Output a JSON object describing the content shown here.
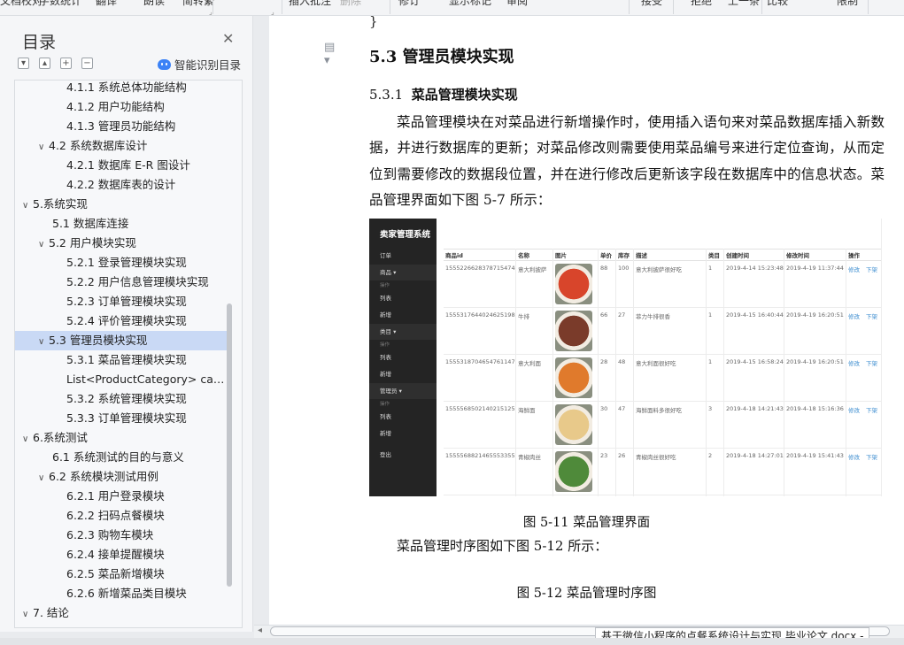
{
  "toolbar": {
    "items": [
      "文档校对",
      "字数统计",
      "翻译",
      "朗读",
      "简转繁",
      "插入批注",
      "删除",
      "修订",
      "显示标记",
      "审阅",
      "接受",
      "拒绝",
      "上一条",
      "比较",
      "限制"
    ]
  },
  "toc": {
    "title": "目录",
    "smart_label": "智能识别目录",
    "controls": [
      "expand",
      "collapse",
      "add-level",
      "remove-level"
    ],
    "items": [
      {
        "label": "4.1.1 系统总体功能结构",
        "level": 3
      },
      {
        "label": "4.1.2 用户功能结构",
        "level": 3
      },
      {
        "label": "4.1.3 管理员功能结构",
        "level": 3
      },
      {
        "label": "4.2 系统数据库设计",
        "level": 2,
        "expanded": true
      },
      {
        "label": "4.2.1 数据库 E-R 图设计",
        "level": 3
      },
      {
        "label": "4.2.2 数据库表的设计",
        "level": 3
      },
      {
        "label": "5.系统实现",
        "level": 1,
        "expanded": true
      },
      {
        "label": "5.1 数据库连接",
        "level": 2
      },
      {
        "label": "5.2 用户模块实现",
        "level": 2,
        "expanded": true
      },
      {
        "label": "5.2.1 登录管理模块实现",
        "level": 3
      },
      {
        "label": "5.2.2 用户信息管理模块实现",
        "level": 3
      },
      {
        "label": "5.2.3 订单管理模块实现",
        "level": 3
      },
      {
        "label": "5.2.4 评价管理模块实现",
        "level": 3
      },
      {
        "label": "5.3 管理员模块实现",
        "level": 2,
        "expanded": true,
        "active": true
      },
      {
        "label": "5.3.1 菜品管理模块实现",
        "level": 3
      },
      {
        "label": "List<ProductCategory> categoryList = pro...",
        "level": 3
      },
      {
        "label": "5.3.2 系统管理模块实现",
        "level": 3
      },
      {
        "label": "5.3.3 订单管理模块实现",
        "level": 3
      },
      {
        "label": "6.系统测试",
        "level": 1,
        "expanded": true
      },
      {
        "label": "6.1 系统测试的目的与意义",
        "level": 2
      },
      {
        "label": "6.2 系统模块测试用例",
        "level": 2,
        "expanded": true
      },
      {
        "label": "6.2.1 用户登录模块",
        "level": 3
      },
      {
        "label": "6.2.2 扫码点餐模块",
        "level": 3
      },
      {
        "label": "6.2.3 购物车模块",
        "level": 3
      },
      {
        "label": "6.2.4 接单提醒模块",
        "level": 3
      },
      {
        "label": "6.2.5 菜品新增模块",
        "level": 3
      },
      {
        "label": "6.2.6 新增菜品类目模块",
        "level": 3
      },
      {
        "label": "7. 结论",
        "level": 1,
        "expanded": true
      }
    ]
  },
  "document": {
    "closing_brace": "}",
    "heading_2": "5.3  管理员模块实现",
    "heading_3_num": "5.3.1",
    "heading_3_text": "菜品管理模块实现",
    "paragraph": "菜品管理模块在对菜品进行新增操作时，使用插入语句来对菜品数据库插入新数据，并进行数据库的更新；对菜品修改则需要使用菜品编号来进行定位查询，从而定位到需要修改的数据段位置，并在进行修改后更新该字段在数据库中的信息状态。菜品管理界面如下图 5-7 所示：",
    "figure_caption": "图 5-11 菜品管理界面",
    "paragraph_2": "菜品管理时序图如下图 5-12 所示：",
    "figure_caption_2": "图 5-12 菜品管理时序图"
  },
  "screenshot": {
    "brand": "卖家管理系统",
    "menu": [
      {
        "label": "订单",
        "type": "item"
      },
      {
        "label": "商品 ▾",
        "type": "group"
      },
      {
        "label": "操作",
        "type": "label"
      },
      {
        "label": "列表",
        "type": "item"
      },
      {
        "label": "新增",
        "type": "item"
      },
      {
        "label": "类目 ▾",
        "type": "group"
      },
      {
        "label": "操作",
        "type": "label"
      },
      {
        "label": "列表",
        "type": "item"
      },
      {
        "label": "新增",
        "type": "item"
      },
      {
        "label": "管理员 ▾",
        "type": "group"
      },
      {
        "label": "操作",
        "type": "label"
      },
      {
        "label": "列表",
        "type": "item"
      },
      {
        "label": "新增",
        "type": "item"
      },
      {
        "label": "登出",
        "type": "item"
      }
    ],
    "columns": [
      "商品id",
      "名称",
      "图片",
      "单价",
      "库存",
      "描述",
      "类目",
      "创建时间",
      "修改时间",
      "操作"
    ],
    "rows": [
      {
        "id": "1555226628378715474",
        "name": "意大利披萨",
        "price": "88",
        "stock": "100",
        "desc": "意大利披萨很好吃",
        "cat": "1",
        "created": "2019-4-14 15:23:48",
        "modified": "2019-4-19 11:37:44",
        "image": "pizza",
        "color": "#d8452b"
      },
      {
        "id": "1555317644024625198",
        "name": "牛排",
        "price": "66",
        "stock": "27",
        "desc": "菲力牛排很香",
        "cat": "1",
        "created": "2019-4-15 16:40:44",
        "modified": "2019-4-19 16:20:51",
        "image": "steak",
        "color": "#7a3b2a"
      },
      {
        "id": "1555318704654761147",
        "name": "意大利面",
        "price": "28",
        "stock": "48",
        "desc": "意大利面很好吃",
        "cat": "1",
        "created": "2019-4-15 16:58:24",
        "modified": "2019-4-19 16:20:51",
        "image": "pasta",
        "color": "#e07a2c"
      },
      {
        "id": "1555568502140215125",
        "name": "海鲜面",
        "price": "30",
        "stock": "47",
        "desc": "海鲜面料多很好吃",
        "cat": "3",
        "created": "2019-4-18 14:21:43",
        "modified": "2019-4-18 15:16:36",
        "image": "seafood-noodles",
        "color": "#e8c98a"
      },
      {
        "id": "1555568821465553355",
        "name": "青椒肉丝",
        "price": "23",
        "stock": "26",
        "desc": "青椒肉丝很好吃",
        "cat": "2",
        "created": "2019-4-18 14:27:01",
        "modified": "2019-4-19 15:41:43",
        "image": "pepper-pork",
        "color": "#4f8a3a"
      }
    ],
    "actions": {
      "edit": "修改",
      "unlist": "下架"
    }
  },
  "tooltip": "基于微信小程序的点餐系统设计与实现 毕业论文.docx -"
}
